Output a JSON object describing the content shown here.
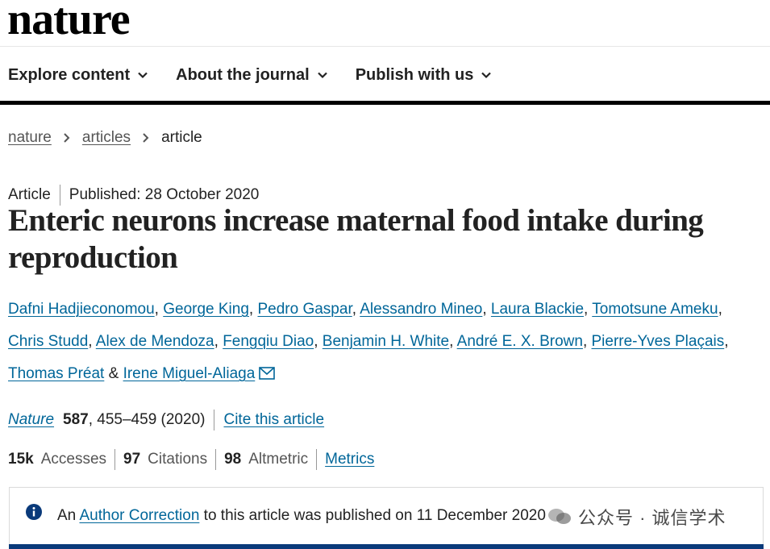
{
  "logo": "nature",
  "nav": [
    {
      "label": "Explore content"
    },
    {
      "label": "About the journal"
    },
    {
      "label": "Publish with us"
    }
  ],
  "breadcrumb": [
    "nature",
    "articles",
    "article"
  ],
  "article_type": "Article",
  "published": "Published: 28 October 2020",
  "title": "Enteric neurons increase maternal food intake during reproduction",
  "authors": [
    "Dafni Hadjieconomou",
    "George King",
    "Pedro Gaspar",
    "Alessandro Mineo",
    "Laura Blackie",
    "Tomotsune Ameku",
    "Chris Studd",
    "Alex de Mendoza",
    "Fengqiu Diao",
    "Benjamin H. White",
    "André E. X. Brown",
    "Pierre-Yves Plaçais",
    "Thomas Préat",
    "Irene Miguel-Aliaga"
  ],
  "authors_joiner": "&",
  "citation": {
    "journal": "Nature",
    "volume": "587",
    "pages_year": ", 455–459 (2020)",
    "cite_link": "Cite this article"
  },
  "metrics": {
    "accesses_value": "15k",
    "accesses_label": "Accesses",
    "citations_value": "97",
    "citations_label": "Citations",
    "altmetric_value": "98",
    "altmetric_label": "Altmetric",
    "metrics_link": "Metrics"
  },
  "notice": {
    "prefix": "An",
    "link": "Author Correction",
    "suffix": "to this article was published on 11 December 2020"
  },
  "watermark": "公众号 · 诚信学术",
  "colors": {
    "link": "#006699",
    "notice_bar": "#0a3a7a",
    "text": "#222222"
  }
}
